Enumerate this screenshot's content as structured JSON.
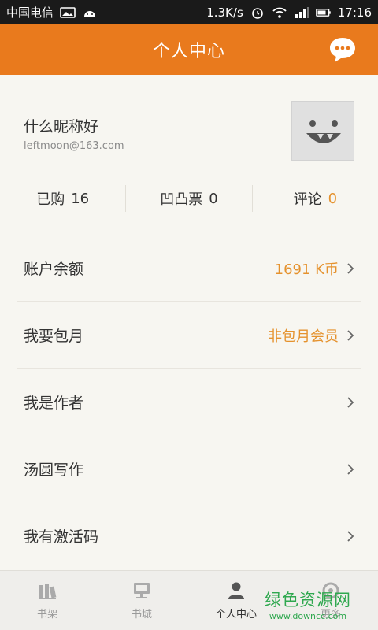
{
  "status": {
    "carrier": "中国电信",
    "speed": "1.3K/s",
    "time": "17:16"
  },
  "titlebar": {
    "title": "个人中心"
  },
  "profile": {
    "nickname": "什么昵称好",
    "email": "leftmoon@163.com"
  },
  "stats": [
    {
      "label": "已购",
      "value": "16"
    },
    {
      "label": "凹凸票",
      "value": "0"
    },
    {
      "label": "评论",
      "value": "0"
    }
  ],
  "menu": [
    {
      "label": "账户余额",
      "value": "1691 K币"
    },
    {
      "label": "我要包月",
      "value": "非包月会员"
    },
    {
      "label": "我是作者",
      "value": ""
    },
    {
      "label": "汤圆写作",
      "value": ""
    },
    {
      "label": "我有激活码",
      "value": ""
    }
  ],
  "tabs": [
    {
      "label": "书架",
      "icon": "bookshelf-icon"
    },
    {
      "label": "书城",
      "icon": "bookstore-icon"
    },
    {
      "label": "个人中心",
      "icon": "user-icon",
      "active": true
    },
    {
      "label": "更多",
      "icon": "more-icon"
    }
  ],
  "watermark": {
    "line1": "绿色资源网",
    "line2": "www.downcc.com"
  },
  "colors": {
    "accent": "#e97a1d",
    "value": "#e5922e"
  }
}
